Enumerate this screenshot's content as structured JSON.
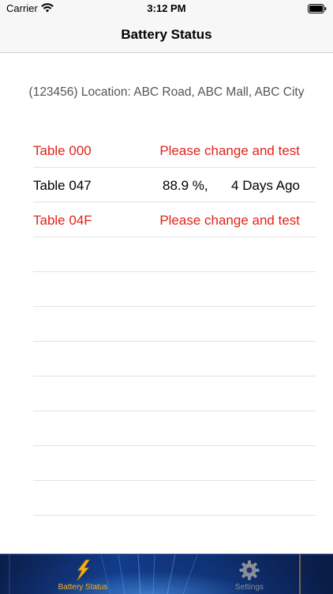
{
  "status_bar": {
    "carrier": "Carrier",
    "time": "3:12 PM"
  },
  "nav": {
    "title": "Battery Status"
  },
  "location": "(123456) Location: ABC Road, ABC Mall, ABC City",
  "tables": [
    {
      "name": "Table 000",
      "status": "Please change and test"
    },
    {
      "name": "Table 047",
      "percent": "88.9 %,",
      "last_test": "4 Days Ago"
    },
    {
      "name": "Table 04F",
      "status": "Please change and test"
    }
  ],
  "tab_bar": {
    "tabs": [
      {
        "label": "Battery Status",
        "icon": "battery-status-icon",
        "selected": true
      },
      {
        "label": "Settings",
        "icon": "gear-icon",
        "selected": false
      }
    ]
  },
  "colors": {
    "alert": "#e2231a",
    "selected_tab": "#f7b21a",
    "inactive_tab": "#8a8f99"
  }
}
